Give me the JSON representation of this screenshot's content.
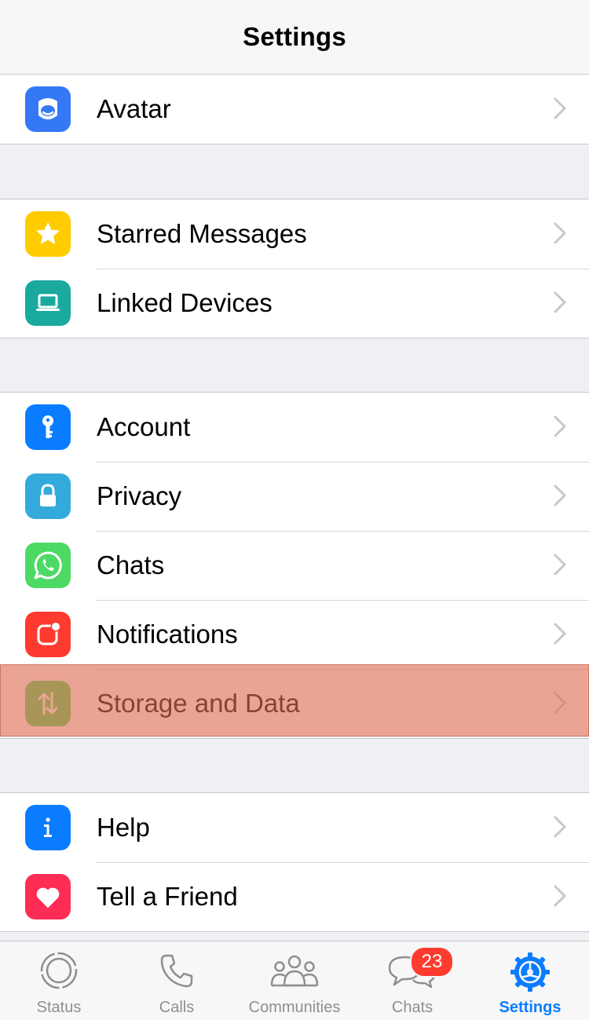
{
  "header": {
    "title": "Settings"
  },
  "groups": {
    "profile": [
      {
        "label": "Avatar",
        "icon": "avatar-icon",
        "color": "#3478f6"
      }
    ],
    "tools": [
      {
        "label": "Starred Messages",
        "icon": "star-icon",
        "color": "#ffcc00"
      },
      {
        "label": "Linked Devices",
        "icon": "laptop-icon",
        "color": "#1aaa9d"
      }
    ],
    "settings": [
      {
        "label": "Account",
        "icon": "key-icon",
        "color": "#0a7cff"
      },
      {
        "label": "Privacy",
        "icon": "lock-icon",
        "color": "#34aadc"
      },
      {
        "label": "Chats",
        "icon": "whatsapp-icon",
        "color": "#4cd964"
      },
      {
        "label": "Notifications",
        "icon": "notification-icon",
        "color": "#ff3b30"
      },
      {
        "label": "Storage and Data",
        "icon": "storage-arrows-icon",
        "color": "#4cd964",
        "highlighted": true
      }
    ],
    "support": [
      {
        "label": "Help",
        "icon": "info-icon",
        "color": "#0a7cff"
      },
      {
        "label": "Tell a Friend",
        "icon": "heart-icon",
        "color": "#ff2d55"
      }
    ]
  },
  "tabbar": {
    "tabs": [
      {
        "label": "Status",
        "icon": "status-icon"
      },
      {
        "label": "Calls",
        "icon": "phone-icon"
      },
      {
        "label": "Communities",
        "icon": "communities-icon"
      },
      {
        "label": "Chats",
        "icon": "chat-bubbles-icon",
        "badge": "23"
      },
      {
        "label": "Settings",
        "icon": "gear-icon",
        "active": true
      }
    ]
  },
  "colors": {
    "accent": "#0a7cff",
    "badge": "#ff3b30",
    "highlight": "#de6c50"
  }
}
